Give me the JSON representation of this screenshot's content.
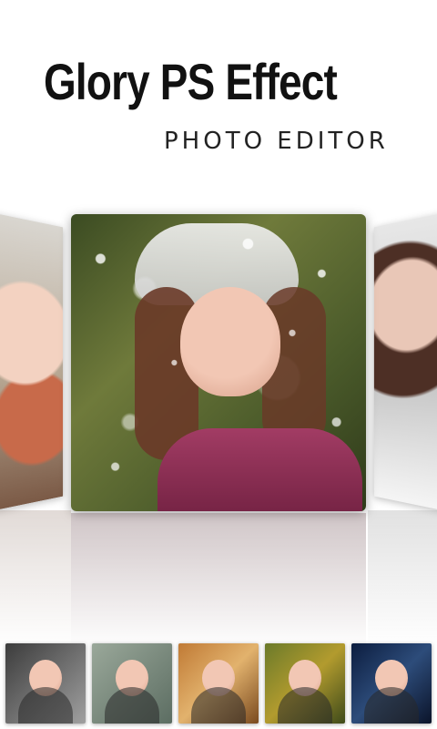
{
  "header": {
    "title": "Glory PS Effect",
    "subtitle": "PHOTO EDITOR"
  },
  "carousel": {
    "items": [
      {
        "name": "left-preview"
      },
      {
        "name": "main-preview"
      },
      {
        "name": "right-preview"
      }
    ]
  },
  "thumbnails": {
    "count": 5
  },
  "colors": {
    "title": "#111111",
    "background": "#ffffff"
  }
}
